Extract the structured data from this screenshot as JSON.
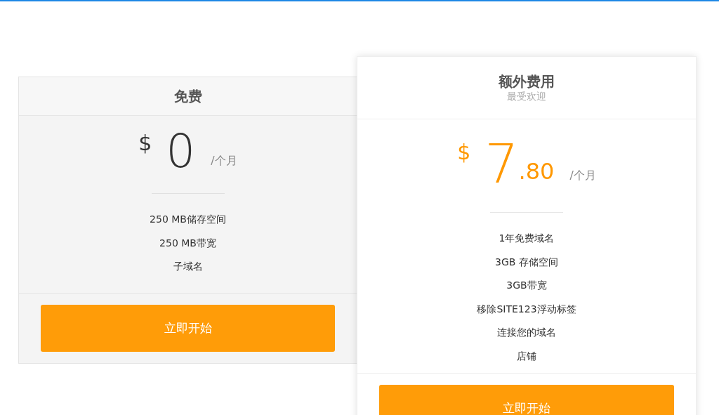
{
  "plans": [
    {
      "name": "免费",
      "featured": false,
      "currency": "$",
      "amount": "0",
      "period": "/个月",
      "features": [
        "250 MB储存空间",
        "250 MB带宽",
        "子域名"
      ],
      "button": "立即开始"
    },
    {
      "name": "额外费用",
      "subtitle": "最受欢迎",
      "featured": true,
      "currency": "$",
      "amount": "7",
      "cents": ".80",
      "period": "/个月",
      "features": [
        "1年免费域名",
        "3GB 存储空间",
        "3GB带宽",
        "移除SITE123浮动标签",
        "连接您的域名",
        "店铺"
      ],
      "button": "立即开始"
    }
  ]
}
